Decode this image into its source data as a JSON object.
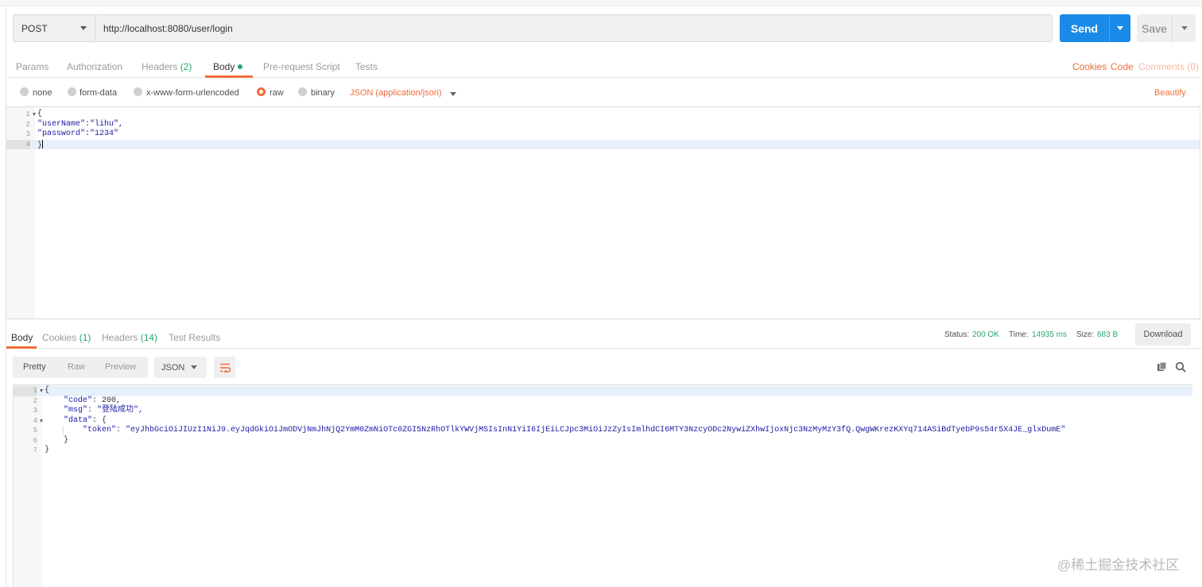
{
  "request": {
    "method": "POST",
    "url": "http://localhost:8080/user/login",
    "send_label": "Send",
    "save_label": "Save"
  },
  "request_tabs": {
    "params": "Params",
    "authorization": "Authorization",
    "headers": "Headers",
    "headers_count": "(2)",
    "body": "Body",
    "prerequest": "Pre-request Script",
    "tests": "Tests",
    "cookies": "Cookies",
    "code": "Code",
    "comments": "Comments (0)",
    "active": "Body"
  },
  "body_types": {
    "none": "none",
    "form_data": "form-data",
    "urlencoded": "x-www-form-urlencoded",
    "raw": "raw",
    "binary": "binary",
    "selected": "raw",
    "content_type": "JSON (application/json)",
    "beautify": "Beautify"
  },
  "request_body": {
    "lines": [
      {
        "n": "1",
        "text": "{"
      },
      {
        "n": "2",
        "text": "\"userName\":\"lihu\","
      },
      {
        "n": "3",
        "text": "\"password\":\"1234\""
      },
      {
        "n": "4",
        "text": "}"
      }
    ]
  },
  "response_tabs": {
    "body": "Body",
    "cookies": "Cookies",
    "cookies_count": "(1)",
    "headers": "Headers",
    "headers_count": "(14)",
    "test_results": "Test Results"
  },
  "response_meta": {
    "status_label": "Status:",
    "status_value": "200 OK",
    "time_label": "Time:",
    "time_value": "14935 ms",
    "size_label": "Size:",
    "size_value": "683 B",
    "download": "Download"
  },
  "view": {
    "pretty": "Pretty",
    "raw": "Raw",
    "preview": "Preview",
    "format": "JSON"
  },
  "response_body": {
    "line_numbers": [
      "1",
      "2",
      "3",
      "4",
      "5",
      "6",
      "7"
    ],
    "l1": "{",
    "code_key": "\"code\"",
    "code_val": "200,",
    "msg_key": "\"msg\"",
    "msg_val": "\"登陆成功\",",
    "data_key": "\"data\"",
    "data_open": "{",
    "token_key": "\"token\"",
    "token_val": "\"eyJhbGciOiJIUzI1NiJ9.eyJqdGkiOiJmODVjNmJhNjQ2YmM0ZmNiOTc0ZGI5NzRhOTlkYWVjMSIsInN1YiI6IjEiLCJpc3MiOiJzZyIsImlhdCI6MTY3NzcyODc2NywiZXhwIjoxNjc3NzMyMzY3fQ.QwgWKrezKXYq714ASiBdTyebP9s54r5X4JE_glxDumE\"",
    "data_close": "}",
    "l7": "}"
  },
  "watermark": "@稀土掘金技术社区",
  "colors": {
    "accent": "#f26b3a",
    "send": "#1a8ae8",
    "status_green": "#27a96c",
    "json_string": "#1a1aa6"
  }
}
